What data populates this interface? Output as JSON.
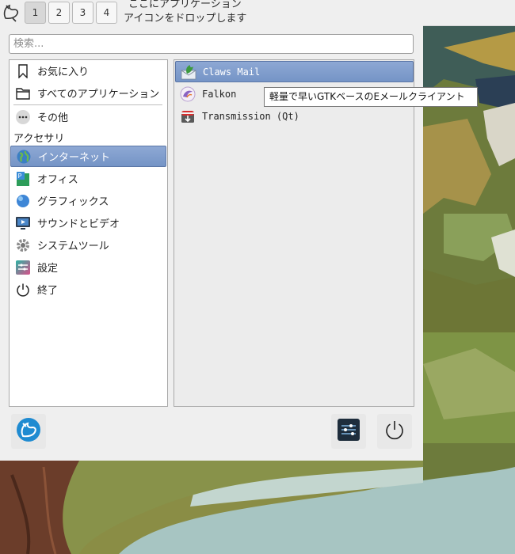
{
  "panel": {
    "workspaces": [
      "1",
      "2",
      "3",
      "4"
    ],
    "active_workspace": "1",
    "drop_hint_line1": "ここにアプリケーション",
    "drop_hint_line2": "アイコンをドロップします"
  },
  "search": {
    "placeholder": "検索..."
  },
  "categories": {
    "favorites": "お気に入り",
    "all_apps": "すべてのアプリケーション",
    "other": "その他",
    "section_heading": "アクセサリ",
    "internet": "インターネット",
    "office": "オフィス",
    "graphics": "グラフィックス",
    "sound_video": "サウンドとビデオ",
    "system_tools": "システムツール",
    "settings": "設定",
    "shutdown": "終了",
    "selected": "インターネット"
  },
  "apps": [
    {
      "label": "Claws Mail",
      "icon": "claws-mail-icon"
    },
    {
      "label": "Falkon",
      "icon": "falkon-icon"
    },
    {
      "label": "Transmission (Qt)",
      "icon": "transmission-icon"
    }
  ],
  "tooltip": "軽量で早いGTKベースのEメールクライアント",
  "colors": {
    "selection": "#7f9bcb",
    "panel_bg": "#efefef"
  }
}
